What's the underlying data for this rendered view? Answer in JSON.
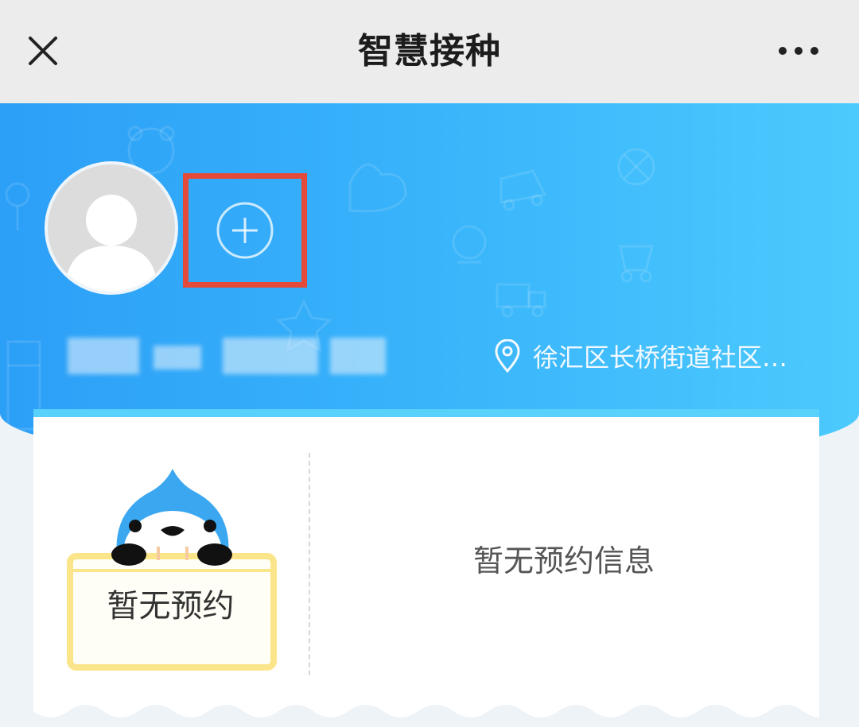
{
  "header": {
    "title": "智慧接种",
    "close_icon": "close-icon",
    "more_icon": "more-icon"
  },
  "profile": {
    "avatar_icon": "avatar-placeholder-icon",
    "add_icon": "add-circle-icon",
    "location_icon": "location-pin-icon",
    "location": "徐汇区长桥街道社区…"
  },
  "card": {
    "left_label": "暂无预约",
    "right_message": "暂无预约信息"
  },
  "colors": {
    "highlight": "#e34a3a",
    "brand_blue": "#2c9ff7",
    "mascot_blue": "#3aa7f0",
    "sign_yellow": "#fbe58a"
  }
}
